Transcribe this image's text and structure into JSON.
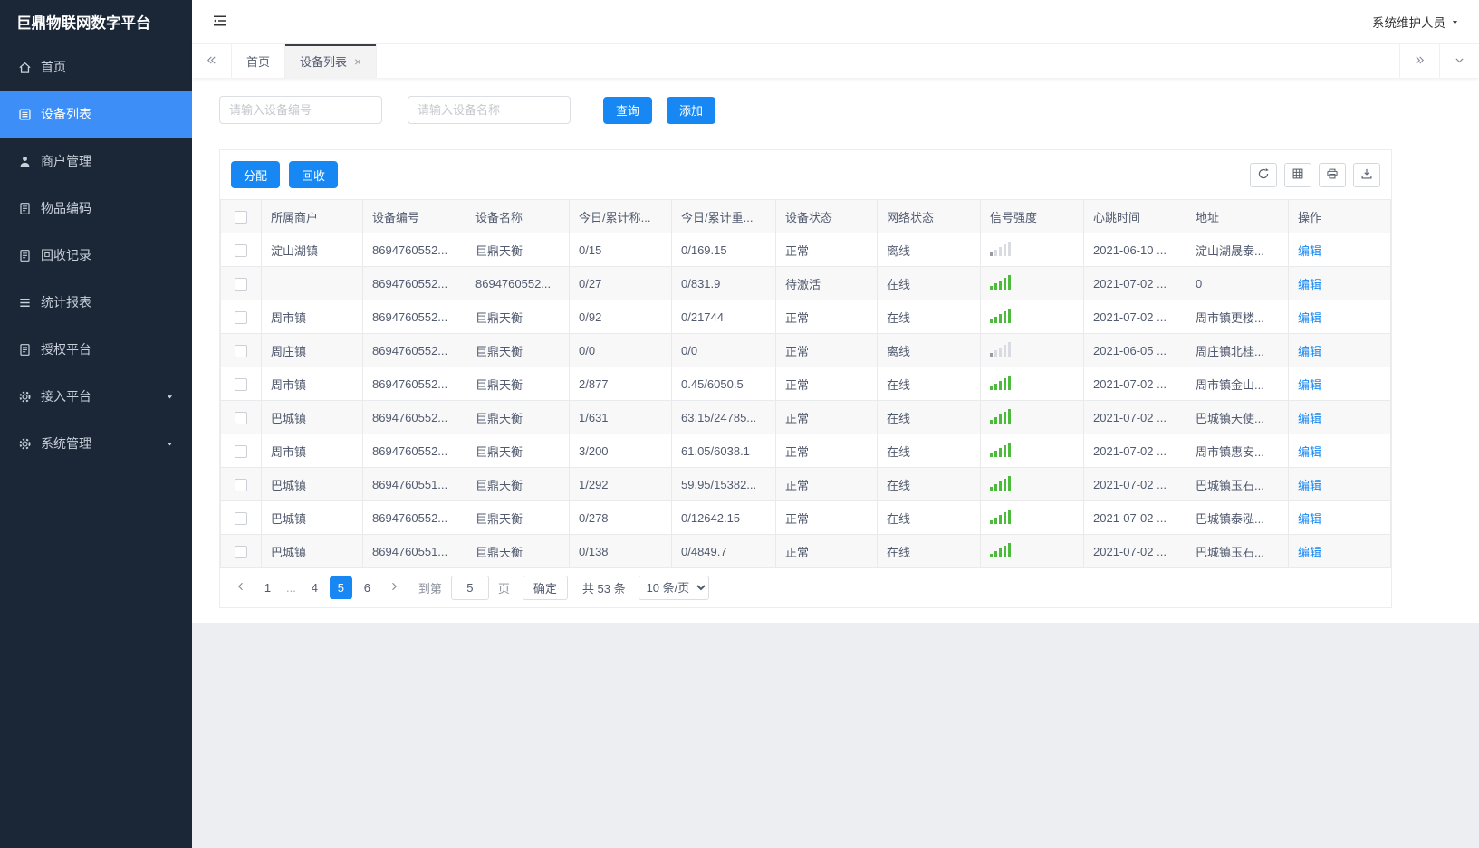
{
  "colors": {
    "accent": "#1788f3",
    "sidebar_active": "#3e8ef7",
    "online_green": "#4cbb3b",
    "offline_red": "#f5222d"
  },
  "app": {
    "title": "巨鼎物联网数字平台",
    "user": "系统维护人员"
  },
  "sidebar": {
    "items": [
      {
        "key": "home",
        "label": "首页",
        "icon": "home-icon"
      },
      {
        "key": "device-list",
        "label": "设备列表",
        "icon": "device-list-icon",
        "active": true
      },
      {
        "key": "merchant-management",
        "label": "商户管理",
        "icon": "user-icon"
      },
      {
        "key": "item-code",
        "label": "物品编码",
        "icon": "doc-icon"
      },
      {
        "key": "recycle-records",
        "label": "回收记录",
        "icon": "doc-icon"
      },
      {
        "key": "statistics-report",
        "label": "统计报表",
        "icon": "report-icon"
      },
      {
        "key": "authorization-platform",
        "label": "授权平台",
        "icon": "doc-icon"
      },
      {
        "key": "access-platform",
        "label": "接入平台",
        "icon": "gear-icon",
        "expandable": true
      },
      {
        "key": "system-management",
        "label": "系统管理",
        "icon": "gear-icon",
        "expandable": true
      }
    ]
  },
  "tabs": [
    {
      "key": "home",
      "label": "首页"
    },
    {
      "key": "device-list",
      "label": "设备列表",
      "active": true,
      "closable": true
    }
  ],
  "search": {
    "device_no_placeholder": "请输入设备编号",
    "device_name_placeholder": "请输入设备名称",
    "query_label": "查询",
    "add_label": "添加"
  },
  "toolbar": {
    "assign_label": "分配",
    "recycle_label": "回收"
  },
  "table": {
    "columns": [
      "所属商户",
      "设备编号",
      "设备名称",
      "今日/累计称...",
      "今日/累计重...",
      "设备状态",
      "网络状态",
      "信号强度",
      "心跳时间",
      "地址",
      "操作"
    ],
    "edit_label": "编辑",
    "rows": [
      {
        "merchant": "淀山湖镇",
        "device_no": "8694760552...",
        "device_name": "巨鼎天衡",
        "count": "0/15",
        "weight": "0/169.15",
        "status": "正常",
        "network": "离线",
        "online": false,
        "signal": "weak",
        "heartbeat": "2021-06-10 ...",
        "address": "淀山湖晟泰..."
      },
      {
        "merchant": "",
        "device_no": "8694760552...",
        "device_name": "8694760552...",
        "count": "0/27",
        "weight": "0/831.9",
        "status": "待激活",
        "network": "在线",
        "online": true,
        "signal": "strong",
        "heartbeat": "2021-07-02 ...",
        "address": "0"
      },
      {
        "merchant": "周市镇",
        "device_no": "8694760552...",
        "device_name": "巨鼎天衡",
        "count": "0/92",
        "weight": "0/21744",
        "status": "正常",
        "network": "在线",
        "online": true,
        "signal": "strong",
        "heartbeat": "2021-07-02 ...",
        "address": "周市镇更楼..."
      },
      {
        "merchant": "周庄镇",
        "device_no": "8694760552...",
        "device_name": "巨鼎天衡",
        "count": "0/0",
        "weight": "0/0",
        "status": "正常",
        "network": "离线",
        "online": false,
        "signal": "weak",
        "heartbeat": "2021-06-05 ...",
        "address": "周庄镇北桂..."
      },
      {
        "merchant": "周市镇",
        "device_no": "8694760552...",
        "device_name": "巨鼎天衡",
        "count": "2/877",
        "weight": "0.45/6050.5",
        "status": "正常",
        "network": "在线",
        "online": true,
        "signal": "strong",
        "heartbeat": "2021-07-02 ...",
        "address": "周市镇金山..."
      },
      {
        "merchant": "巴城镇",
        "device_no": "8694760552...",
        "device_name": "巨鼎天衡",
        "count": "1/631",
        "weight": "63.15/24785...",
        "status": "正常",
        "network": "在线",
        "online": true,
        "signal": "strong",
        "heartbeat": "2021-07-02 ...",
        "address": "巴城镇天使..."
      },
      {
        "merchant": "周市镇",
        "device_no": "8694760552...",
        "device_name": "巨鼎天衡",
        "count": "3/200",
        "weight": "61.05/6038.1",
        "status": "正常",
        "network": "在线",
        "online": true,
        "signal": "strong",
        "heartbeat": "2021-07-02 ...",
        "address": "周市镇惠安..."
      },
      {
        "merchant": "巴城镇",
        "device_no": "8694760551...",
        "device_name": "巨鼎天衡",
        "count": "1/292",
        "weight": "59.95/15382...",
        "status": "正常",
        "network": "在线",
        "online": true,
        "signal": "strong",
        "heartbeat": "2021-07-02 ...",
        "address": "巴城镇玉石..."
      },
      {
        "merchant": "巴城镇",
        "device_no": "8694760552...",
        "device_name": "巨鼎天衡",
        "count": "0/278",
        "weight": "0/12642.15",
        "status": "正常",
        "network": "在线",
        "online": true,
        "signal": "strong",
        "heartbeat": "2021-07-02 ...",
        "address": "巴城镇泰泓..."
      },
      {
        "merchant": "巴城镇",
        "device_no": "8694760551...",
        "device_name": "巨鼎天衡",
        "count": "0/138",
        "weight": "0/4849.7",
        "status": "正常",
        "network": "在线",
        "online": true,
        "signal": "strong",
        "heartbeat": "2021-07-02 ...",
        "address": "巴城镇玉石..."
      }
    ]
  },
  "pagination": {
    "pages": [
      "1",
      "...",
      "4",
      "5",
      "6"
    ],
    "current": "5",
    "goto_label": "到第",
    "goto_value": "5",
    "page_unit": "页",
    "confirm_label": "确定",
    "total_label": "共 53 条",
    "page_size_value": "10 条/页"
  }
}
